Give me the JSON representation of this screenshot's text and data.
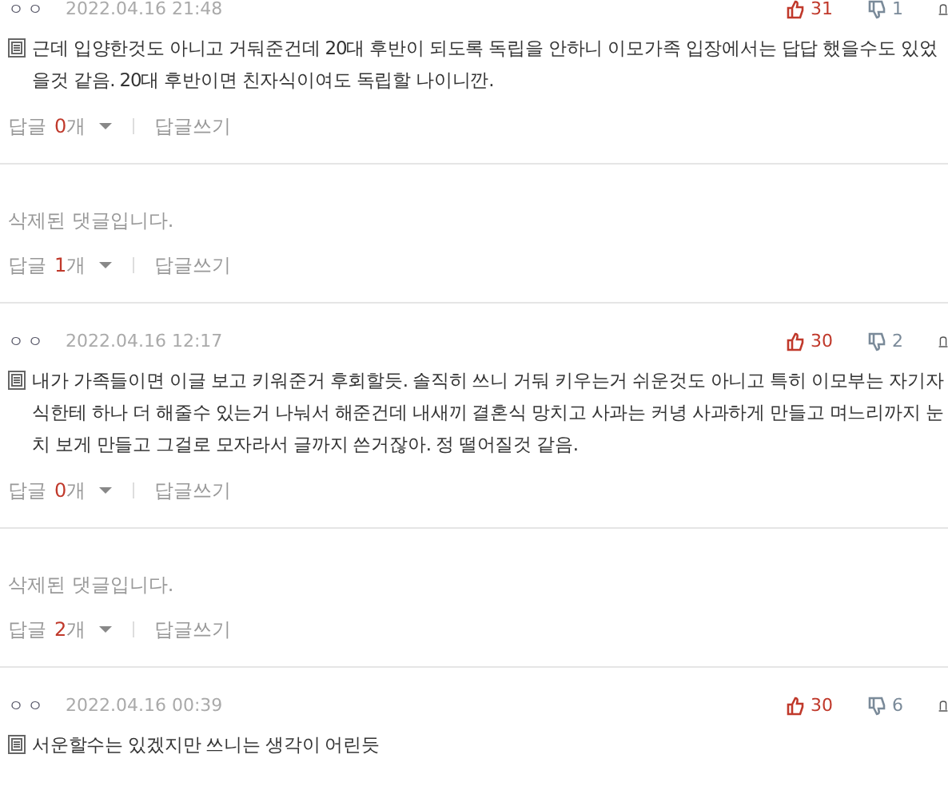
{
  "comments": [
    {
      "kind": "comment",
      "author": "ㅇㅇ",
      "date": "2022.04.16 21:48",
      "likes": "31",
      "dislikes": "1",
      "text": "근데 입양한것도 아니고 거둬준건데 20대 후반이 되도록 독립을 안하니 이모가족 입장에서는 답답 했을수도 있었을것 같음. 20대 후반이면 친자식이여도 독립할 나이니깐.",
      "reply_label": "답글",
      "reply_count": "0개",
      "write_reply": "답글쓰기"
    },
    {
      "kind": "deleted",
      "text": "삭제된 댓글입니다.",
      "reply_label": "답글",
      "reply_count": "1개",
      "write_reply": "답글쓰기"
    },
    {
      "kind": "comment",
      "author": "ㅇㅇ",
      "date": "2022.04.16 12:17",
      "likes": "30",
      "dislikes": "2",
      "text": "내가 가족들이면 이글 보고 키워준거 후회할듯. 솔직히 쓰니 거둬 키우는거 쉬운것도 아니고 특히 이모부는 자기자식한테 하나 더 해줄수 있는거 나눠서 해준건데 내새끼 결혼식 망치고 사과는 커녕 사과하게 만들고 며느리까지 눈치 보게 만들고 그걸로 모자라서 글까지 쓴거잖아. 정 떨어질것 같음.",
      "reply_label": "답글",
      "reply_count": "0개",
      "write_reply": "답글쓰기"
    },
    {
      "kind": "deleted",
      "text": "삭제된 댓글입니다.",
      "reply_label": "답글",
      "reply_count": "2개",
      "write_reply": "답글쓰기"
    },
    {
      "kind": "comment",
      "author": "ㅇㅇ",
      "date": "2022.04.16 00:39",
      "likes": "30",
      "dislikes": "6",
      "text": "서운할수는 있겠지만 쓰니는 생각이 어린듯"
    }
  ]
}
